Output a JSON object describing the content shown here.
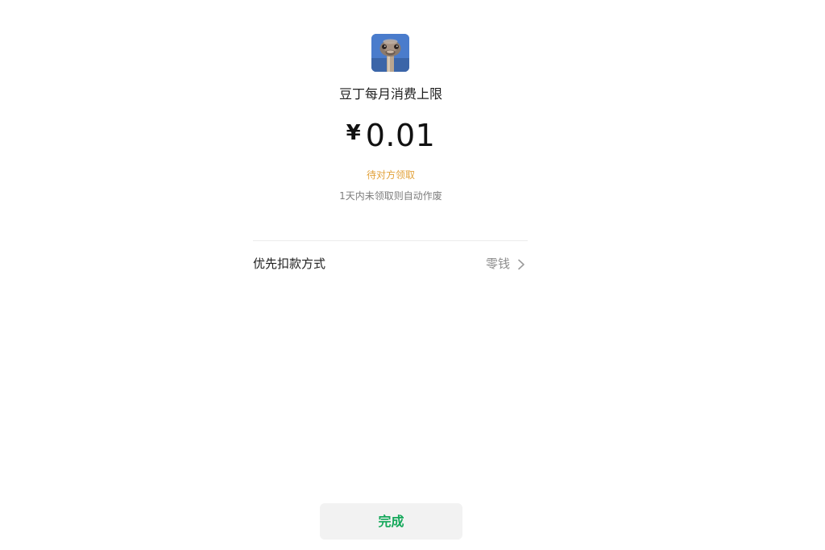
{
  "header": {
    "avatar": "ostrich-avatar",
    "title": "豆丁每月消费上限"
  },
  "amount": {
    "currency": "¥",
    "value": "0.01"
  },
  "status": {
    "text": "待对方领取",
    "note": "1天内未领取则自动作废",
    "color": "#e2a23b"
  },
  "payment": {
    "label": "优先扣款方式",
    "value": "零钱",
    "icon": "chevron-right-icon"
  },
  "footer": {
    "done_label": "完成",
    "accent": "#14a85a"
  }
}
